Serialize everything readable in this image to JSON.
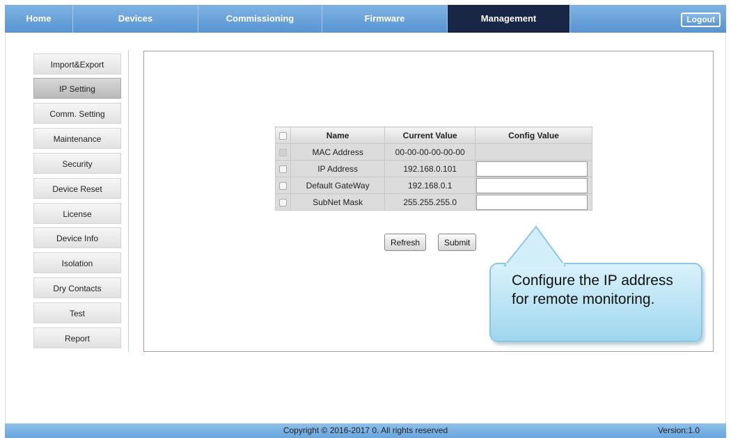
{
  "nav": {
    "items": [
      "Home",
      "Devices",
      "Commissioning",
      "Firmware",
      "Management"
    ],
    "active": "Management",
    "logout_label": "Logout"
  },
  "sidebar": {
    "items": [
      "Import&Export",
      "IP Setting",
      "Comm. Setting",
      "Maintenance",
      "Security",
      "Device Reset",
      "License",
      "Device Info",
      "Isolation",
      "Dry Contacts",
      "Test",
      "Report"
    ],
    "active": "IP Setting"
  },
  "table": {
    "headers": {
      "name": "Name",
      "current": "Current Value",
      "config": "Config Value"
    },
    "rows": [
      {
        "name": "MAC Address",
        "current": "00-00-00-00-00-00",
        "config": ""
      },
      {
        "name": "IP Address",
        "current": "192.168.0.101",
        "config": ""
      },
      {
        "name": "Default GateWay",
        "current": "192.168.0.1",
        "config": ""
      },
      {
        "name": "SubNet Mask",
        "current": "255.255.255.0",
        "config": ""
      }
    ]
  },
  "buttons": {
    "refresh": "Refresh",
    "submit": "Submit"
  },
  "callout": {
    "text": "Configure the IP address for remote monitoring."
  },
  "footer": {
    "copyright": "Copyright © 2016-2017 0. All rights reserved",
    "version": "Version:1.0"
  },
  "colors": {
    "nav": "#6aa3dc",
    "nav_active": "#1a2646",
    "callout": "#b7e2f4"
  }
}
